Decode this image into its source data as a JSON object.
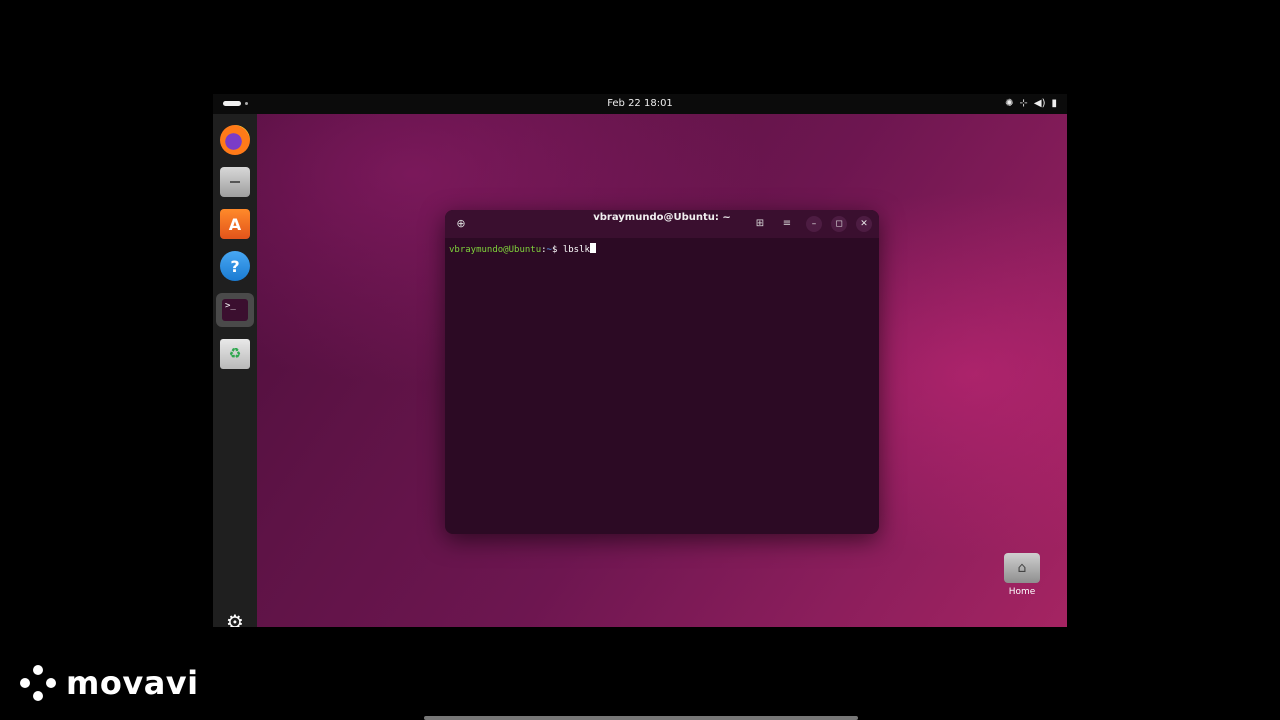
{
  "topbar": {
    "clock": "Feb 22  18:01",
    "tray_icons": [
      "accessibility-icon",
      "network-icon",
      "volume-icon",
      "battery-icon"
    ]
  },
  "dock": {
    "items": [
      {
        "name": "firefox",
        "glyph": ""
      },
      {
        "name": "files",
        "glyph": ""
      },
      {
        "name": "software",
        "glyph": "A"
      },
      {
        "name": "help",
        "glyph": "?"
      },
      {
        "name": "terminal",
        "glyph": ">_"
      },
      {
        "name": "trash",
        "glyph": "♻"
      }
    ],
    "apps_glyph": "⚙"
  },
  "terminal": {
    "title": "vbraymundo@Ubuntu: ~",
    "newtab_glyph": "⊕",
    "header_buttons": {
      "grid": "⊞",
      "menu": "≡",
      "minimize": "–",
      "maximize": "◻",
      "close": "✕"
    },
    "prompt_user": "vbraymundo@Ubuntu",
    "prompt_sep": ":",
    "prompt_path": "~",
    "prompt_symbol": "$ ",
    "command": "lbslk"
  },
  "desktop": {
    "home_label": "Home",
    "home_glyph": "⌂"
  },
  "watermark": {
    "text": "movavi"
  }
}
